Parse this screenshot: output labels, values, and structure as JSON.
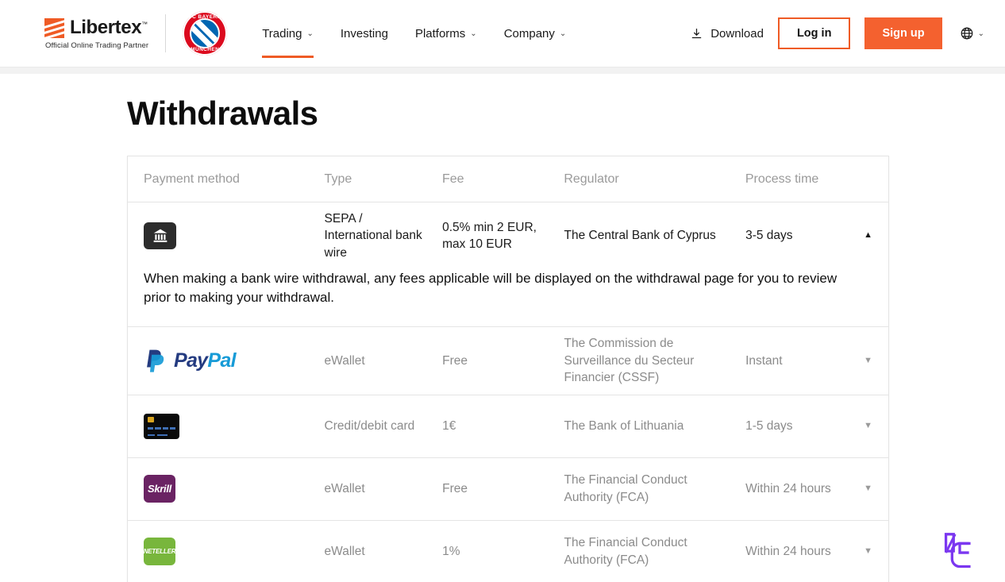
{
  "header": {
    "brand": {
      "name": "Libertex",
      "tm": "™",
      "tagline": "Official Online Trading Partner",
      "partner_top": "FC BAYERN",
      "partner_bottom": "MÜNCHEN"
    },
    "nav": [
      {
        "label": "Trading",
        "has_dropdown": true,
        "active": true
      },
      {
        "label": "Investing",
        "has_dropdown": false,
        "active": false
      },
      {
        "label": "Platforms",
        "has_dropdown": true,
        "active": false
      },
      {
        "label": "Company",
        "has_dropdown": true,
        "active": false
      }
    ],
    "download_label": "Download",
    "login_label": "Log in",
    "signup_label": "Sign up",
    "accent_color": "#ef5b25",
    "signup_color": "#f4612f"
  },
  "main": {
    "page_title": "Withdrawals",
    "table": {
      "columns": [
        "Payment method",
        "Type",
        "Fee",
        "Regulator",
        "Process time"
      ],
      "rows": [
        {
          "icon": "bank-icon",
          "method_name": "",
          "type": "SEPA / International bank wire",
          "fee": "0.5% min 2 EUR, max 10 EUR",
          "regulator": "The Central Bank of Cyprus",
          "process_time": "3-5 days",
          "expanded": true,
          "caret": "▲",
          "detail": "When making a bank wire withdrawal, any fees applicable will be displayed on the withdrawal page for you to review prior to making your withdrawal."
        },
        {
          "icon": "paypal-icon",
          "method_name": "PayPal",
          "type": "eWallet",
          "fee": "Free",
          "regulator": "The Commission de Surveillance du Secteur Financier (CSSF)",
          "process_time": "Instant",
          "expanded": false,
          "caret": "▼",
          "detail": ""
        },
        {
          "icon": "credit-card-icon",
          "method_name": "",
          "type": "Credit/debit card",
          "fee": "1€",
          "regulator": "The Bank of Lithuania",
          "process_time": "1-5 days",
          "expanded": false,
          "caret": "▼",
          "detail": ""
        },
        {
          "icon": "skrill-icon",
          "method_name": "Skrill",
          "type": "eWallet",
          "fee": "Free",
          "regulator": "The Financial Conduct Authority (FCA)",
          "process_time": "Within 24 hours",
          "expanded": false,
          "caret": "▼",
          "detail": ""
        },
        {
          "icon": "neteller-icon",
          "method_name": "NETELLER",
          "type": "eWallet",
          "fee": "1%",
          "regulator": "The Financial Conduct Authority (FCA)",
          "process_time": "Within 24 hours",
          "expanded": false,
          "caret": "▼",
          "detail": ""
        }
      ]
    }
  },
  "watermark": {
    "color": "#7b37f0"
  }
}
